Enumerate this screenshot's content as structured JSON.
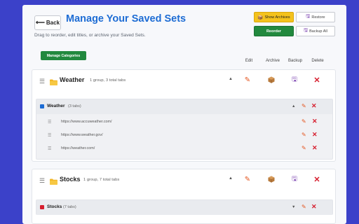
{
  "header": {
    "back_label": "Back",
    "title": "Manage Your Saved Sets",
    "subtitle": "Drag to reorder, edit titles, or archive your Saved Sets."
  },
  "toolbar": {
    "show_archives_label": "Show Archives",
    "restore_label": "Restore",
    "reorder_label": "Reorder",
    "backup_all_label": "Backup All"
  },
  "manage_categories_label": "Manage Categories",
  "columns": {
    "edit": "Edit",
    "archive": "Archive",
    "backup": "Backup",
    "delete": "Delete"
  },
  "colors": {
    "accent": "#1d6cd4",
    "green": "#22893e",
    "yellow": "#f4c21d",
    "delete": "#d61e2e",
    "edit": "#e4541e",
    "backup": "#6a2aa6",
    "background": "#3b41c9"
  },
  "categories": [
    {
      "name": "Weather",
      "meta": "1 group, 3 total tabs",
      "groups": [
        {
          "name": "Weather",
          "count": "(3 tabs)",
          "color": "#1d6cd4",
          "tabs": [
            "https://www.accuweather.com/",
            "https://www.weather.gov/",
            "https://weather.com/"
          ]
        }
      ]
    },
    {
      "name": "Stocks",
      "meta": "1 group, 7 total tabs",
      "groups": [
        {
          "name": "Stocks",
          "count": "(7 tabs)",
          "color": "#d61e2e"
        }
      ]
    }
  ],
  "icons": {
    "back": "left-arrow-icon",
    "show_archives": "box-icon",
    "restore": "floppy-disk-icon",
    "backup_all": "floppy-disk-icon",
    "drag": "drag-handle-icon",
    "folder": "folder-icon",
    "edit": "pencil-icon",
    "archive": "box-icon",
    "backup": "floppy-disk-icon",
    "delete": "x-icon",
    "collapse": "caret-up-icon",
    "expand": "caret-down-icon"
  }
}
